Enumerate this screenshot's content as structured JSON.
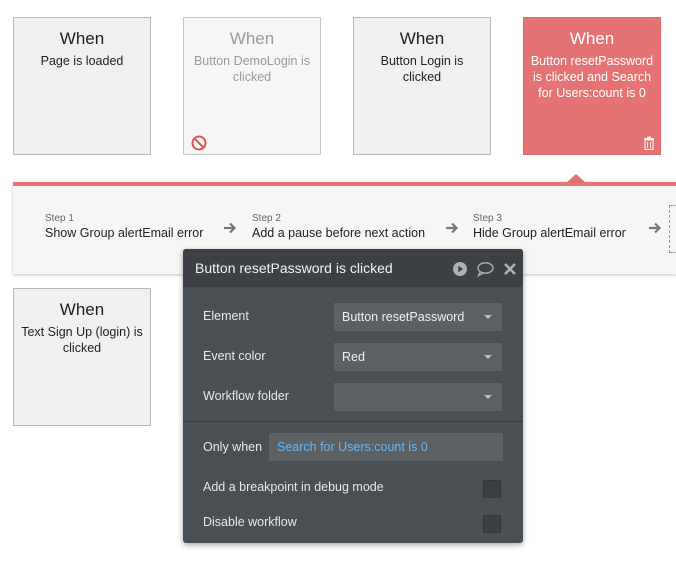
{
  "events": [
    {
      "when": "When",
      "description": "Page is loaded"
    },
    {
      "when": "When",
      "description": "Button DemoLogin is clicked"
    },
    {
      "when": "When",
      "description": "Button Login is clicked"
    },
    {
      "when": "When",
      "description": "Button resetPassword is clicked and Search for Users:count is 0"
    }
  ],
  "event_lower": {
    "when": "When",
    "description": "Text Sign Up (login) is clicked"
  },
  "steps": [
    {
      "number": "Step 1",
      "name": "Show Group alertEmail error"
    },
    {
      "number": "Step 2",
      "name": "Add a pause before next action"
    },
    {
      "number": "Step 3",
      "name": "Hide Group alertEmail error"
    }
  ],
  "panel": {
    "title": "Button resetPassword is clicked",
    "element_label": "Element",
    "element_value": "Button resetPassword",
    "event_color_label": "Event color",
    "event_color_value": "Red",
    "workflow_folder_label": "Workflow folder",
    "workflow_folder_value": "",
    "only_when_label": "Only when",
    "only_when_value": "Search for Users:count is 0",
    "breakpoint_label": "Add a breakpoint in debug mode",
    "disable_label": "Disable workflow",
    "icons": [
      "play-icon",
      "comment-icon",
      "close-icon"
    ]
  },
  "colors": {
    "event_red": "#e57373",
    "panel_bg": "#4a4f54",
    "expression_blue": "#6cb4ef"
  }
}
